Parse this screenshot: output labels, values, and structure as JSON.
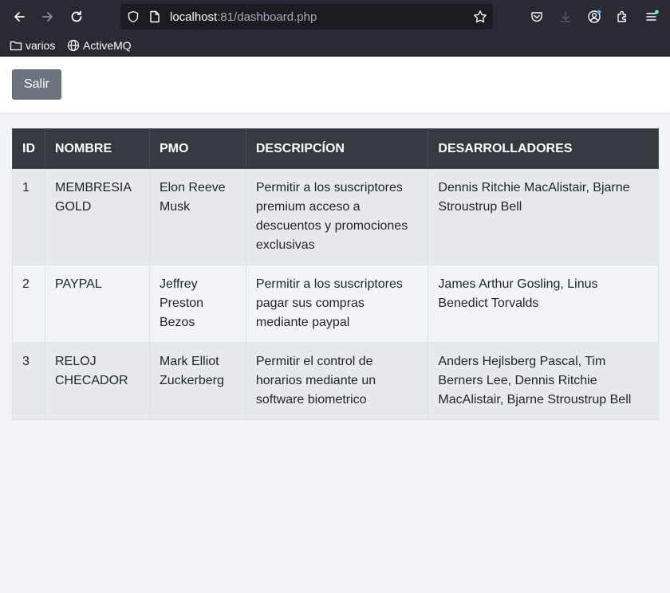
{
  "browser": {
    "url_host": "localhost",
    "url_rest": ":81/dashboard.php",
    "bookmarks": [
      "varios",
      "ActiveMQ"
    ]
  },
  "header": {
    "logout_label": "Salir"
  },
  "table": {
    "headers": [
      "ID",
      "NOMBRE",
      "PMO",
      "DESCRIPCÍON",
      "DESARROLLADORES"
    ],
    "rows": [
      [
        "1",
        "MEMBRESIA GOLD",
        "Elon Reeve Musk",
        "Permitir a los suscriptores premium acceso a descuentos y promociones exclusivas",
        "Dennis Ritchie MacAlistair, Bjarne Stroustrup Bell"
      ],
      [
        "2",
        "PAYPAL",
        "Jeffrey Preston Bezos",
        "Permitir a los suscriptores pagar sus compras mediante paypal",
        "James Arthur Gosling, Linus Benedict Torvalds"
      ],
      [
        "3",
        "RELOJ CHECADOR",
        "Mark Elliot Zuckerberg",
        "Permitir el control de horarios mediante un software biometrico",
        "Anders Hejlsberg Pascal, Tim Berners Lee, Dennis Ritchie MacAlistair, Bjarne Stroustrup Bell"
      ]
    ]
  },
  "colors": {
    "table_header_bg": "#343a40",
    "button_bg": "#6c757d",
    "page_bg": "#f3f4f8"
  }
}
